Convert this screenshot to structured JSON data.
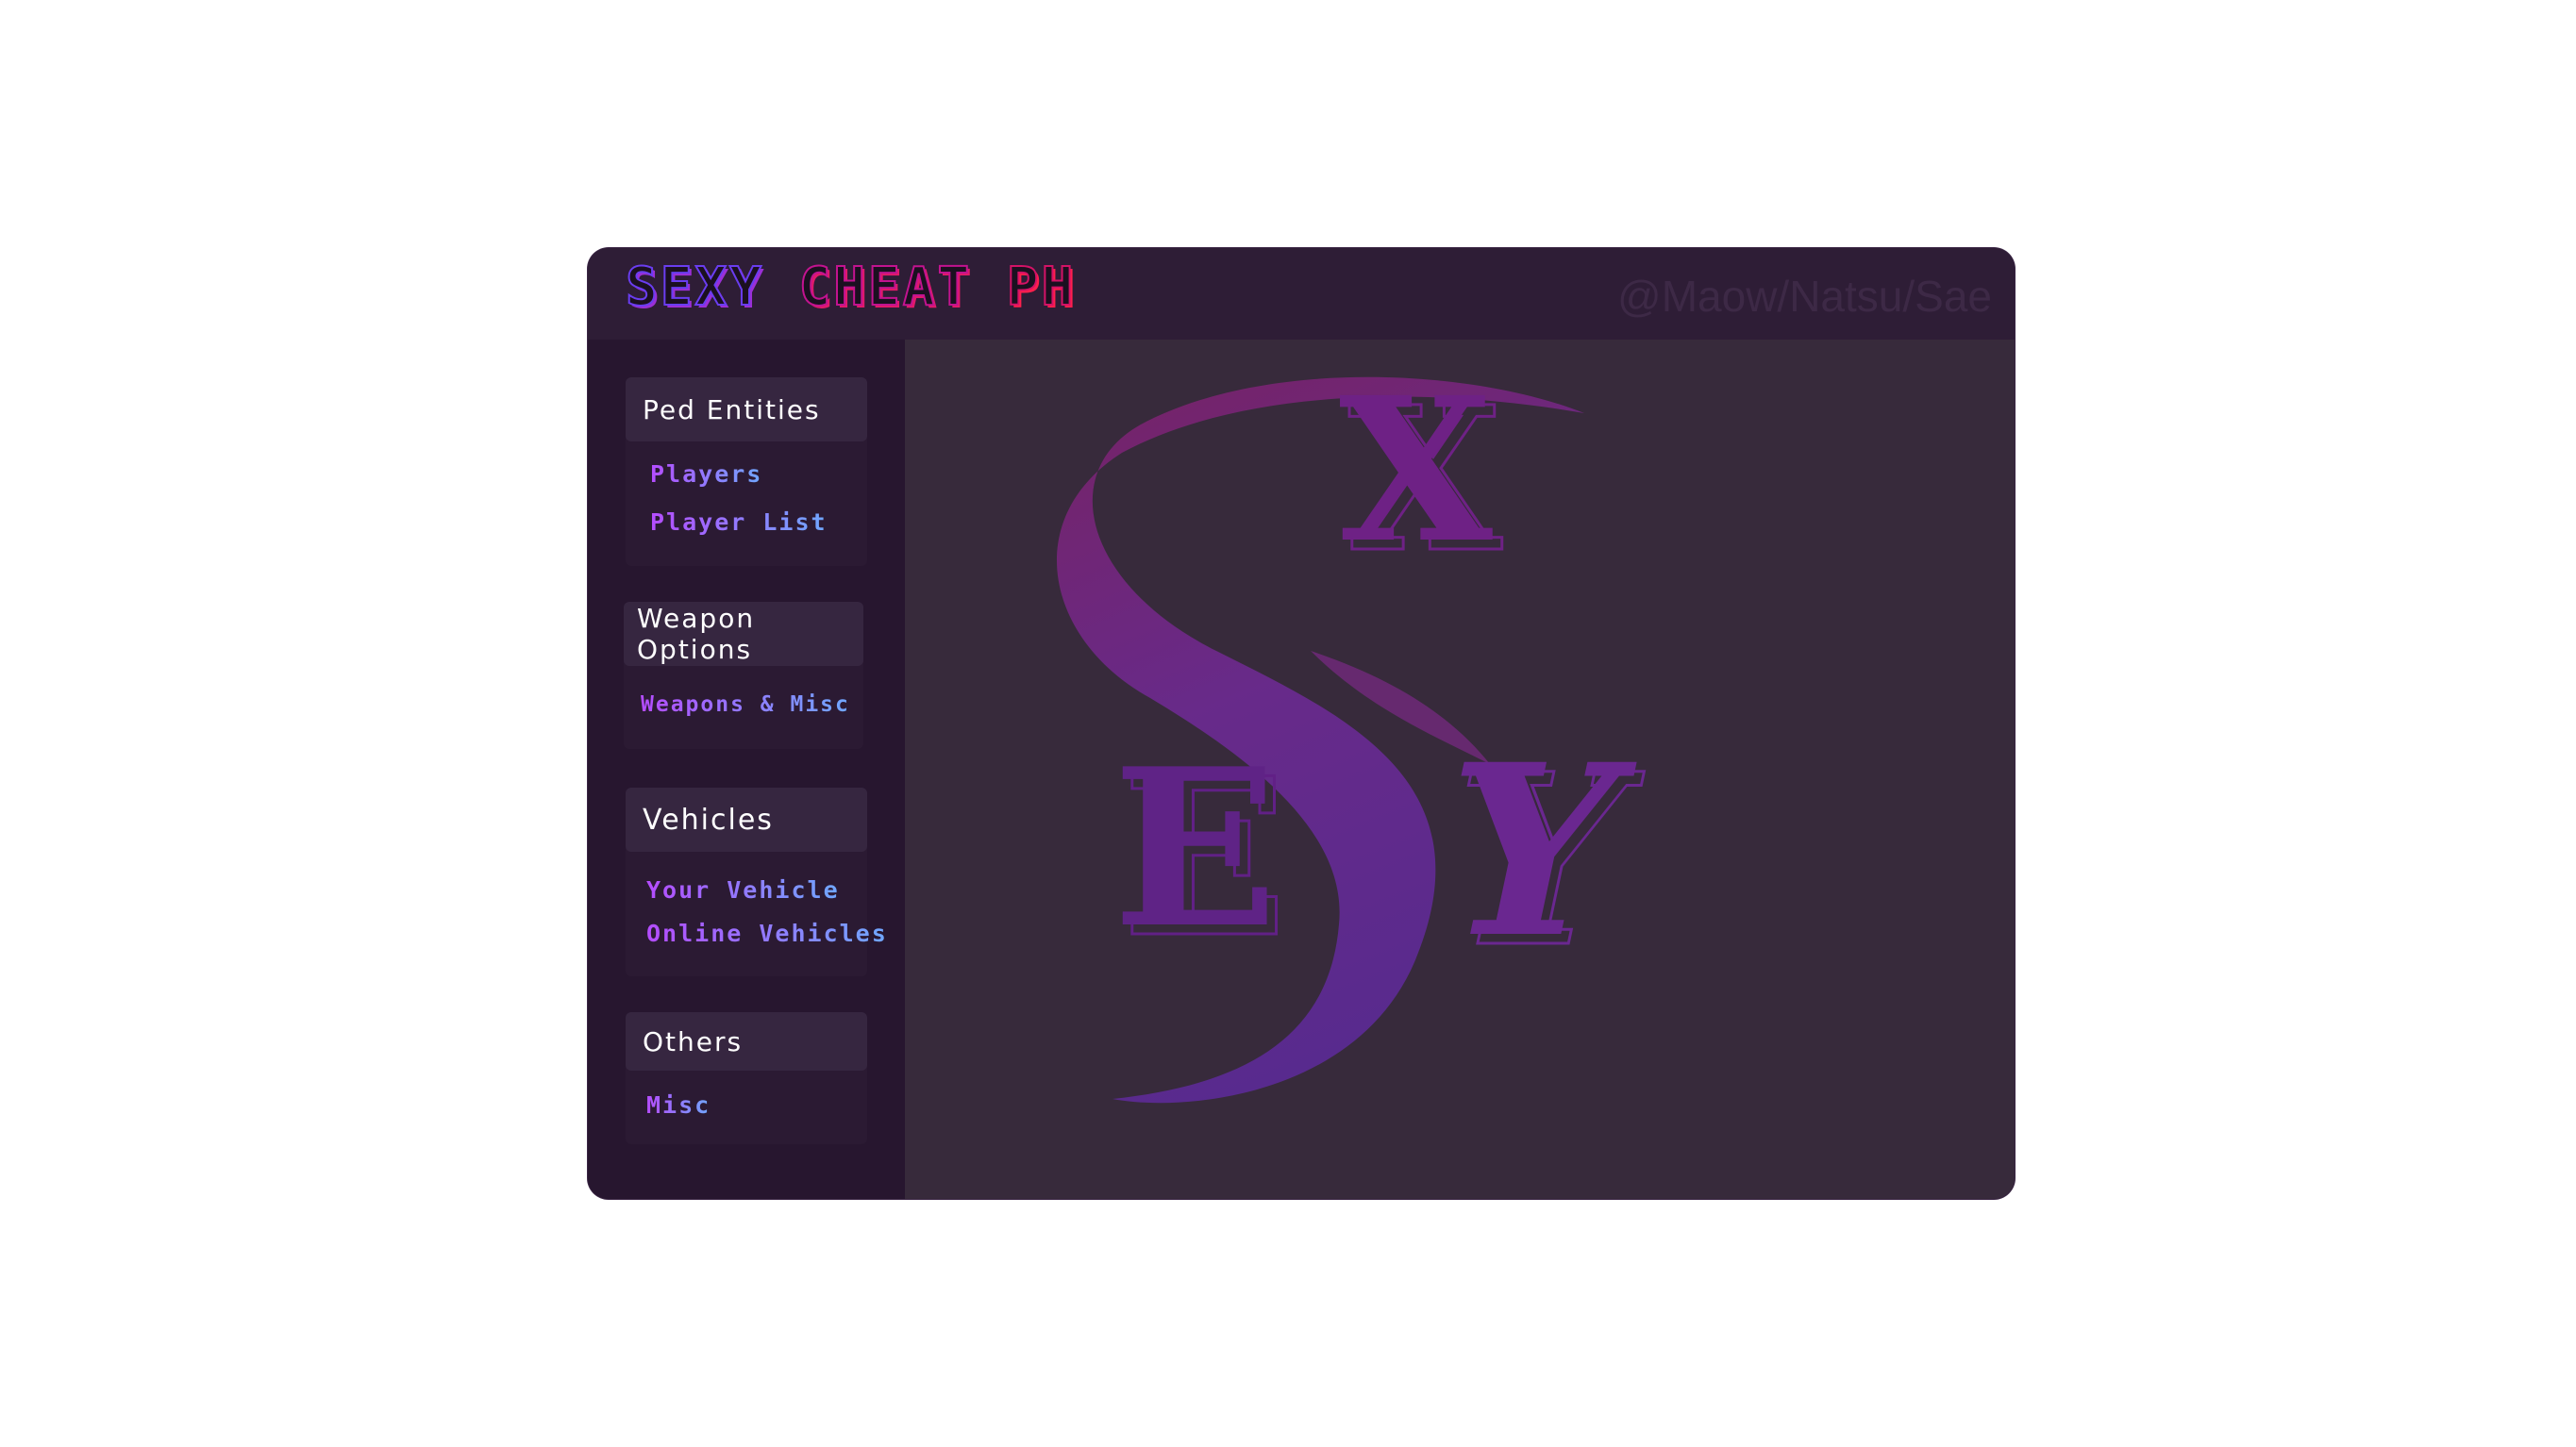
{
  "title": {
    "logo_words": [
      "SEXY",
      "CHEAT",
      "PH"
    ],
    "watermark": "@Maow/Natsu/Sae"
  },
  "sidebar": {
    "groups": [
      {
        "header": "Ped Entities",
        "items": [
          "Players",
          "Player List"
        ]
      },
      {
        "header": "Weapon Options",
        "items": [
          "Weapons & Misc"
        ]
      },
      {
        "header": "Vehicles",
        "items": [
          "Your Vehicle",
          "Online Vehicles"
        ]
      },
      {
        "header": "Others",
        "items": [
          "Misc"
        ]
      }
    ]
  },
  "main": {
    "emblem_letters": [
      "S",
      "X",
      "E",
      "Y"
    ]
  },
  "colors": {
    "window_bg": "#2b1a33",
    "main_bg": "#372a3b",
    "accent_purple": "#6b2a9a",
    "accent_magenta": "#8a1f6e"
  }
}
